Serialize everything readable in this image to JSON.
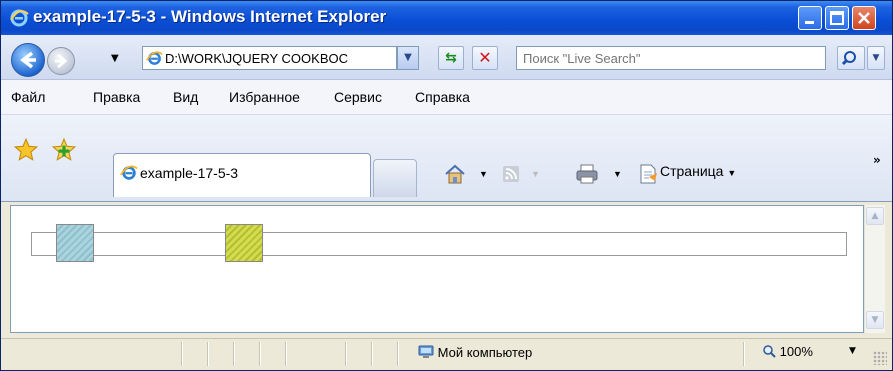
{
  "window": {
    "title": "example-17-5-3 - Windows Internet Explorer"
  },
  "nav": {
    "back_icon": "back-arrow-icon",
    "forward_icon": "forward-arrow-icon",
    "address": "D:\\WORK\\JQUERY COOKBOC",
    "search_placeholder": "Поиск \"Live Search\""
  },
  "menu": {
    "items": [
      "Файл",
      "Правка",
      "Вид",
      "Избранное",
      "Сервис",
      "Справка"
    ]
  },
  "tabs": {
    "active_label": "example-17-5-3",
    "page_label": "Страница"
  },
  "content": {
    "slider": {
      "handle1_color": "#a9d3dd",
      "handle2_color": "#d3dc50"
    }
  },
  "status": {
    "zone": "Мой компьютер",
    "zoom": "100%"
  },
  "colors": {
    "titlebar": "#0a4fd6",
    "close_button": "#d0431f"
  }
}
